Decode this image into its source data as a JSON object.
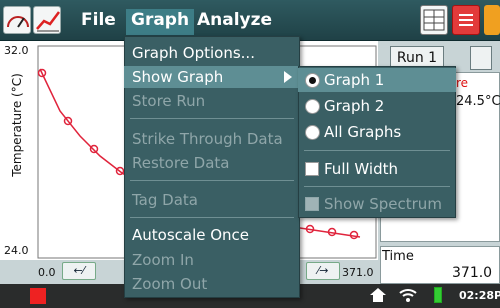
{
  "menubar": {
    "file": "File",
    "graph": "Graph",
    "analyze": "Analyze"
  },
  "graph_menu": {
    "items": [
      {
        "label": "Graph Options...",
        "enabled": true
      },
      {
        "label": "Show Graph",
        "enabled": true,
        "active": true,
        "has_submenu": true
      },
      {
        "label": "Store Run",
        "enabled": false
      },
      {
        "label": "Strike Through Data",
        "enabled": false
      },
      {
        "label": "Restore Data",
        "enabled": false
      },
      {
        "label": "Tag Data",
        "enabled": false
      },
      {
        "label": "Autoscale Once",
        "enabled": true
      },
      {
        "label": "Zoom In",
        "enabled": false
      },
      {
        "label": "Zoom Out",
        "enabled": false
      }
    ]
  },
  "show_graph_submenu": {
    "graph1": "Graph 1",
    "graph2": "Graph 2",
    "all_graphs": "All Graphs",
    "full_width": "Full Width",
    "show_spectrum": "Show Spectrum",
    "selected": "Graph 1"
  },
  "graph": {
    "y_title": "Temperature (°C)",
    "y_max": "32.0",
    "y_min": "24.0",
    "x_min": "0.0",
    "x_max": "371.0"
  },
  "right_panel": {
    "run_tab": "Run 1",
    "meter_label_fragment": "re",
    "meter_value": "24.5°C",
    "time_label": "Time",
    "time_value": "371.0"
  },
  "status": {
    "clock": "02:28P"
  },
  "colors": {
    "menu_bg": "#3a5f64",
    "menu_active": "#5e8e94",
    "curve": "#e0243c"
  }
}
